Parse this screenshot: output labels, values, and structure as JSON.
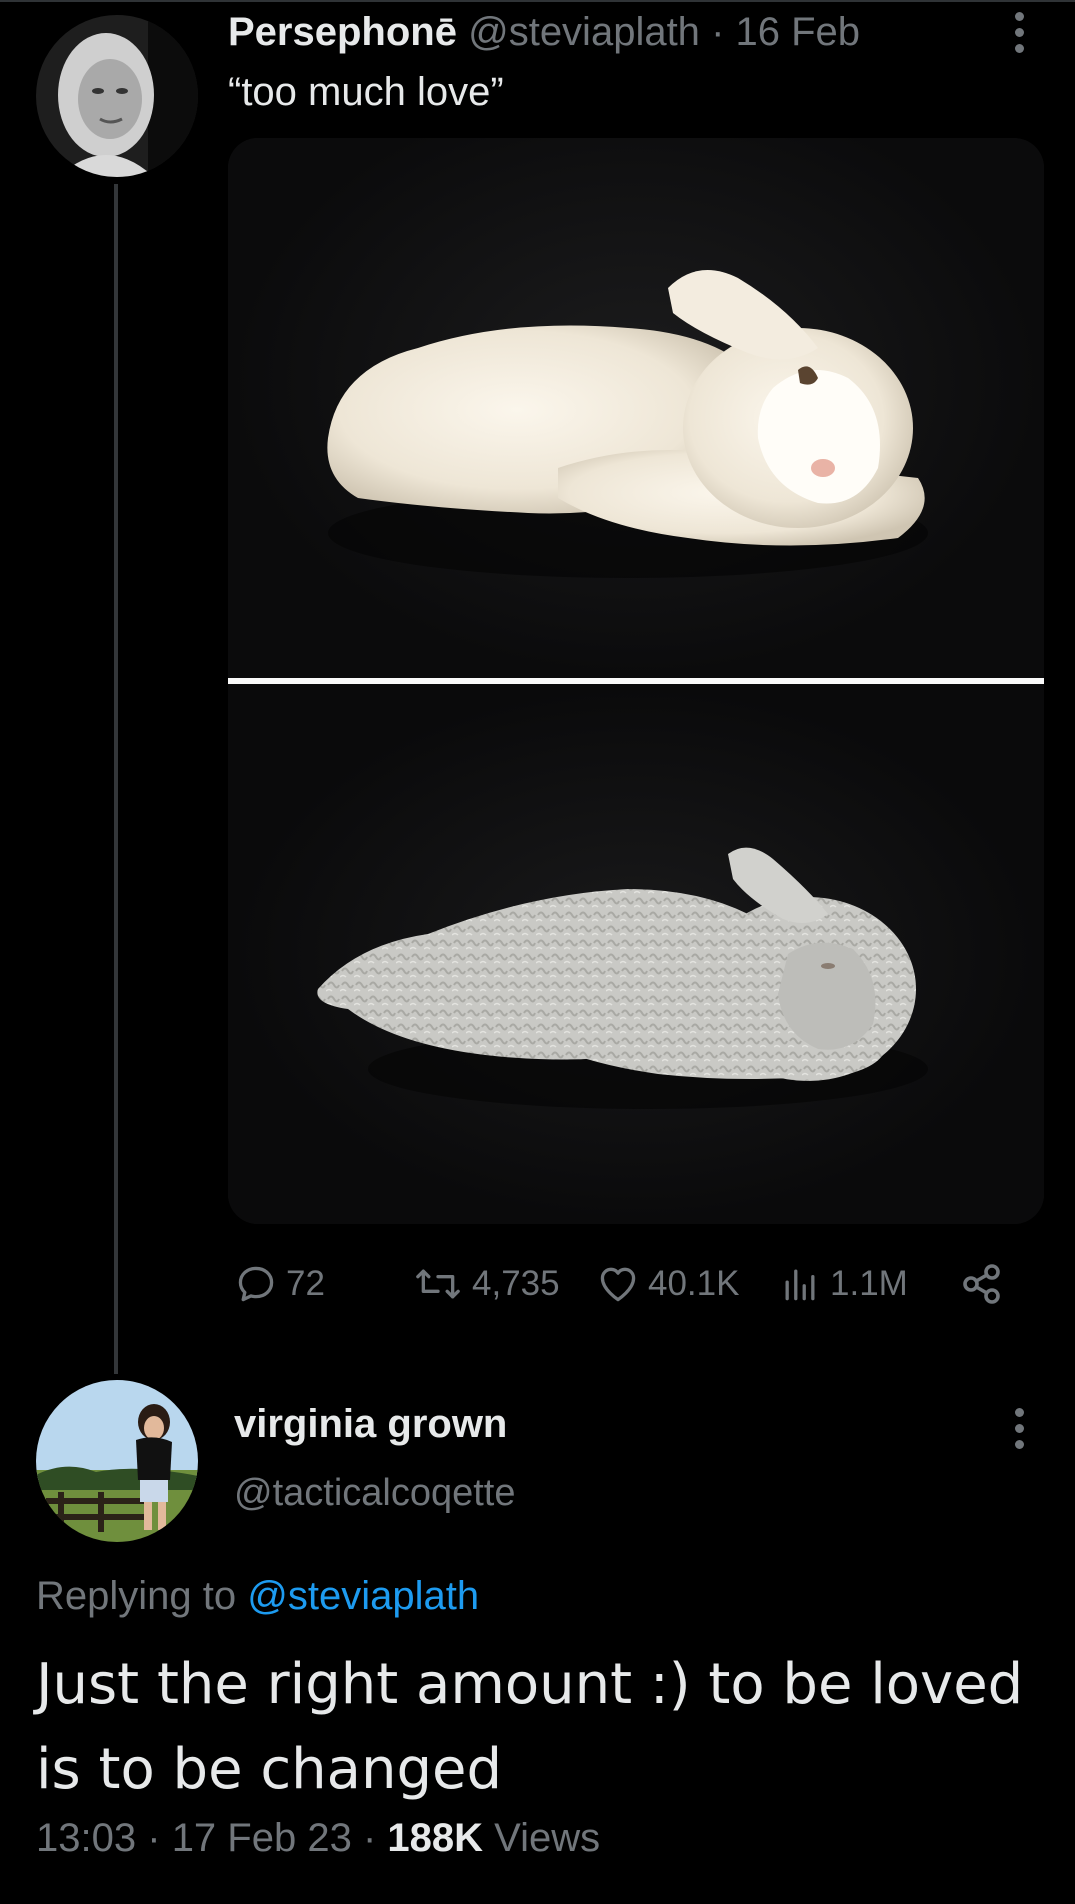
{
  "parent_tweet": {
    "display_name": "Persephonē",
    "handle": "@steviaplath",
    "separator": "·",
    "date": "16 Feb",
    "text": "“too much love”",
    "avatar_icon": "grayscale-portrait-avatar",
    "actions": {
      "reply_count": "72",
      "retweet_count": "4,735",
      "like_count": "40.1K",
      "views_count": "1.1M"
    }
  },
  "reply_tweet": {
    "display_name": "virginia grown",
    "handle": "@tacticalcoqette",
    "avatar_icon": "outdoor-photo-avatar",
    "replying_label": "Replying to",
    "replying_to": "@steviaplath",
    "text": "Just the right amount :) to be loved is to be changed",
    "time": "13:03",
    "sep1": "·",
    "date": "17 Feb 23",
    "sep2": "·",
    "views_count": "188K",
    "views_label": "Views"
  },
  "colors": {
    "background": "#000000",
    "text_primary": "#e7e9ea",
    "text_muted": "#71767b",
    "link": "#1d9bf0"
  }
}
